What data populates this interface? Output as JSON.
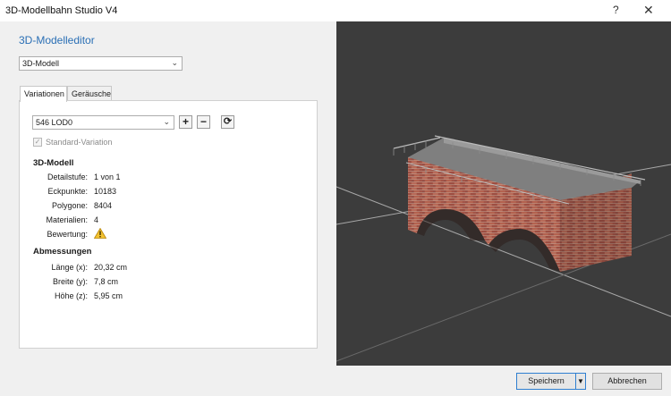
{
  "window": {
    "title": "3D-Modellbahn Studio V4",
    "help": "?",
    "close": "✕"
  },
  "editor": {
    "heading": "3D-Modelleditor",
    "mode_select": "3D-Modell",
    "tabs": [
      {
        "label": "Variationen",
        "active": true
      },
      {
        "label": "Geräusche",
        "active": false
      }
    ],
    "variation_select": "546 LOD0",
    "add_symbol": "+",
    "remove_symbol": "−",
    "refresh_symbol": "⟳",
    "standard_variation": {
      "label": "Standard-Variation",
      "checked": true
    },
    "model_section": {
      "title": "3D-Modell",
      "rows": [
        {
          "label": "Detailstufe:",
          "value": "1 von 1"
        },
        {
          "label": "Eckpunkte:",
          "value": "10183"
        },
        {
          "label": "Polygone:",
          "value": "8404"
        },
        {
          "label": "Materialien:",
          "value": "4"
        },
        {
          "label": "Bewertung:",
          "icon": "warning-icon"
        }
      ]
    },
    "dimensions_section": {
      "title": "Abmessungen",
      "rows": [
        {
          "label": "Länge (x):",
          "value": "20,32 cm"
        },
        {
          "label": "Breite (y):",
          "value": "7,8 cm"
        },
        {
          "label": "Höhe (z):",
          "value": "5,95 cm"
        }
      ]
    }
  },
  "footer": {
    "save_label": "Speichern",
    "save_dropdown": "▼",
    "cancel_label": "Abbrechen"
  },
  "colors": {
    "accent": "#2a6fb5",
    "viewport_bg": "#3c3c3c",
    "brick": "#a9594a",
    "warning": "#f2c230"
  }
}
